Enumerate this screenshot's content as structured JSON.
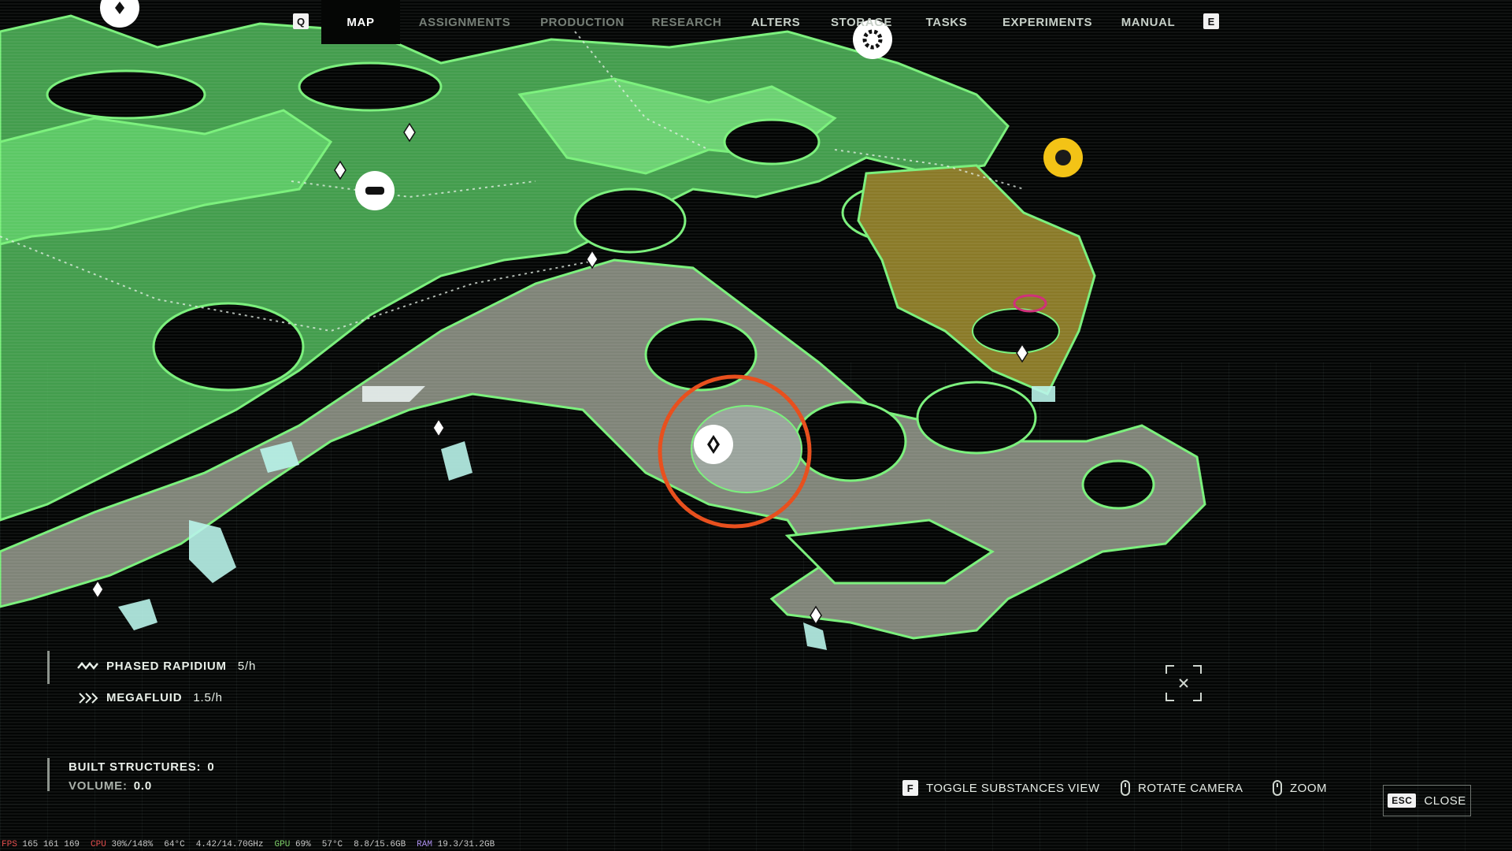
{
  "nav": {
    "key_left": "Q",
    "key_right": "E",
    "tabs": [
      {
        "label": "MAP",
        "active": true
      },
      {
        "label": "ASSIGNMENTS",
        "active": false
      },
      {
        "label": "PRODUCTION",
        "active": false
      },
      {
        "label": "RESEARCH",
        "active": false
      },
      {
        "label": "ALTERS",
        "active": false
      },
      {
        "label": "STORAGE",
        "active": false
      },
      {
        "label": "TASKS",
        "active": false
      },
      {
        "label": "EXPERIMENTS",
        "active": false
      },
      {
        "label": "MANUAL",
        "active": false
      }
    ]
  },
  "resources": [
    {
      "name": "PHASED RAPIDIUM",
      "rate": "5/h",
      "icon": "wave-icon"
    },
    {
      "name": "MEGAFLUID",
      "rate": "1.5/h",
      "icon": "megafluid-icon"
    }
  ],
  "stats": {
    "built_label": "BUILT STRUCTURES:",
    "built_value": "0",
    "volume_label": "VOLUME:",
    "volume_value": "0.0"
  },
  "controls": {
    "toggle_key": "F",
    "toggle_label": "TOGGLE SUBSTANCES VIEW",
    "rotate_label": "ROTATE CAMERA",
    "zoom_label": "ZOOM",
    "close_key": "ESC",
    "close_label": "CLOSE"
  },
  "perf": {
    "fps_label": "FPS",
    "fps_value": "165 161 169",
    "cpu_label": "CPU",
    "cpu_value": "30%/148%",
    "cpu_temp": "64°C",
    "cpu_clock": "4.42/14.70GHz",
    "gpu_label": "GPU",
    "gpu_value": "69%",
    "gpu_temp": "57°C",
    "vram": "8.8/15.6GB",
    "ram_label": "RAM",
    "ram_value": "19.3/31.2GB"
  },
  "colors": {
    "terrain_green": "#4fb85a",
    "terrain_edge": "#79f07a",
    "terrain_grey": "#8a8f82",
    "terrain_olive": "#8a7a28",
    "highlight_ring": "#e8501e",
    "marker_yellow": "#f3c316",
    "background": "#030504"
  }
}
